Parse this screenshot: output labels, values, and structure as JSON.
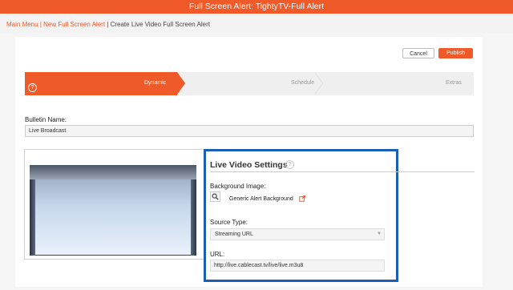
{
  "header": {
    "title": "Full Screen Alert: TightyTV-Full Alert"
  },
  "breadcrumb": {
    "main_menu": "Main Menu",
    "separator": "|",
    "new_alert": "New Full Screen Alert",
    "current": "Create Live Video Full Screen Alert"
  },
  "toolbar": {
    "cancel_label": "Cancel",
    "publish_label": "Publish"
  },
  "wizard": {
    "steps": [
      {
        "label": "Dynamic",
        "active": true
      },
      {
        "label": "Schedule",
        "active": false
      },
      {
        "label": "Extras",
        "active": false
      }
    ],
    "help_glyph": "?"
  },
  "bulletin": {
    "label": "Bulletin Name:",
    "value": "Live Broadcast"
  },
  "live_video": {
    "title": "Live Video Settings",
    "help_glyph": "?",
    "background_label": "Background Image:",
    "background_value": "Generic Alert Background",
    "source_label": "Source Type:",
    "source_value": "Streaming URL",
    "url_label": "URL:",
    "url_value": "http://live.cablecast.tv/live/live.m3u8"
  },
  "colors": {
    "accent": "#f05a28",
    "highlight": "#1a5fb4"
  },
  "icons": {
    "search": "search-icon",
    "external": "external-link-icon",
    "caret": "chevron-down-icon"
  }
}
